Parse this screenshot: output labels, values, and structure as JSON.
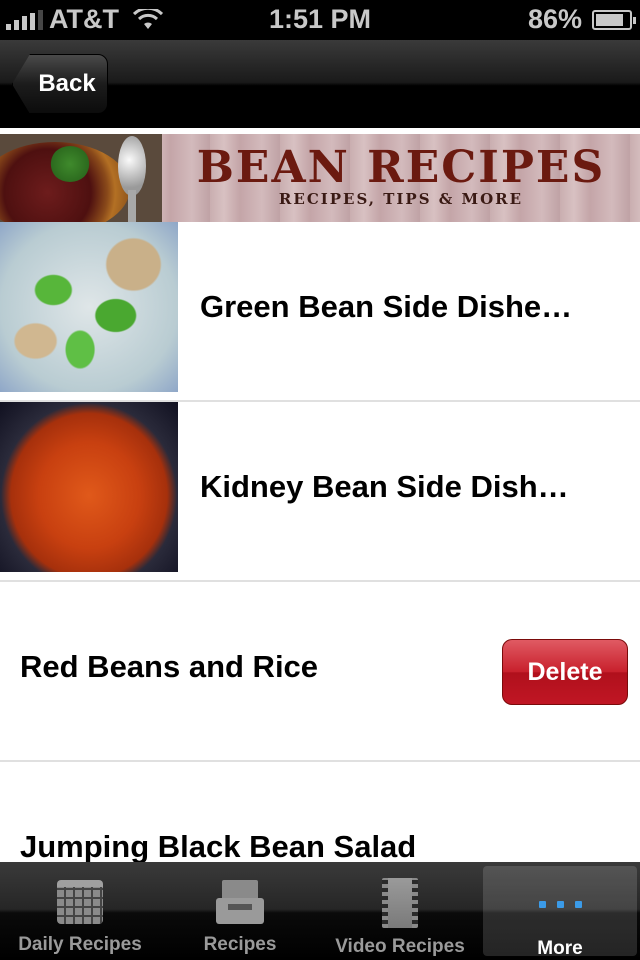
{
  "status_bar": {
    "carrier": "AT&T",
    "time": "1:51 PM",
    "battery": "86%",
    "battery_level": 86
  },
  "nav": {
    "back_label": "Back"
  },
  "banner": {
    "title": "BEAN RECIPES",
    "subtitle": "RECIPES, TIPS & MORE"
  },
  "list": {
    "items": [
      {
        "title": "Green Bean Side Dishe…",
        "thumbnail": "green-beans-photo"
      },
      {
        "title": "Kidney Bean Side Dish…",
        "thumbnail": "kidney-beans-photo"
      },
      {
        "title": "Red Beans and Rice",
        "action": "Delete"
      },
      {
        "title": "Jumping Black Bean Salad"
      }
    ]
  },
  "tab_bar": {
    "tabs": [
      {
        "label": "Daily Recipes",
        "icon": "calendar-icon"
      },
      {
        "label": "Recipes",
        "icon": "tray-icon"
      },
      {
        "label": "Video Recipes",
        "icon": "film-icon"
      },
      {
        "label": "More",
        "icon": "more-icon",
        "active": true
      }
    ]
  },
  "colors": {
    "delete_red": "#c8202c",
    "active_dots": "#3b9be8",
    "banner_text": "#6b1a10"
  }
}
